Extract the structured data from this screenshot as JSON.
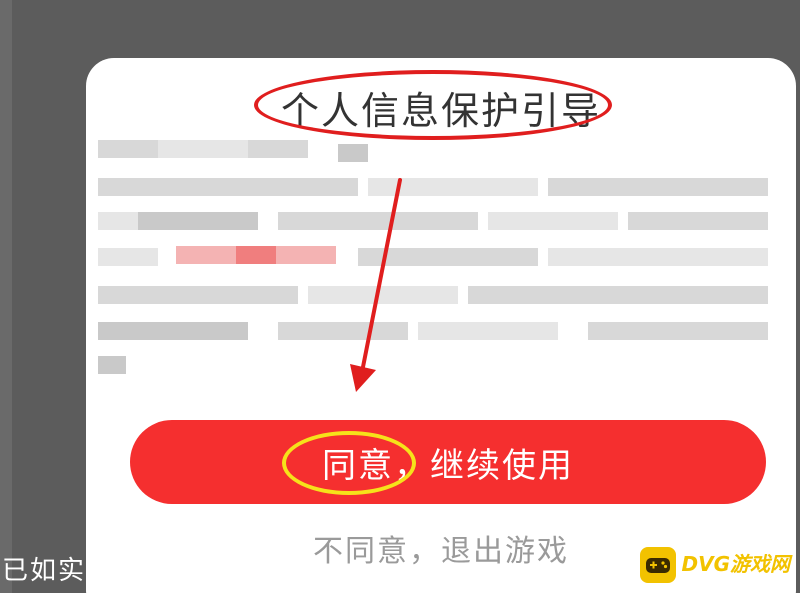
{
  "dialog": {
    "title": "个人信息保护引导",
    "agree_label": "同意，继续使用",
    "decline_label": "不同意，退出游戏"
  },
  "background": {
    "partial_text": "已如实"
  },
  "watermark": {
    "brand": "DVG游戏网"
  },
  "colors": {
    "agree_button": "#f52f2f",
    "title_highlight_ring": "#e01e1e",
    "agree_highlight_ring": "#f6e21a",
    "decline_text": "#9a9a9a"
  }
}
